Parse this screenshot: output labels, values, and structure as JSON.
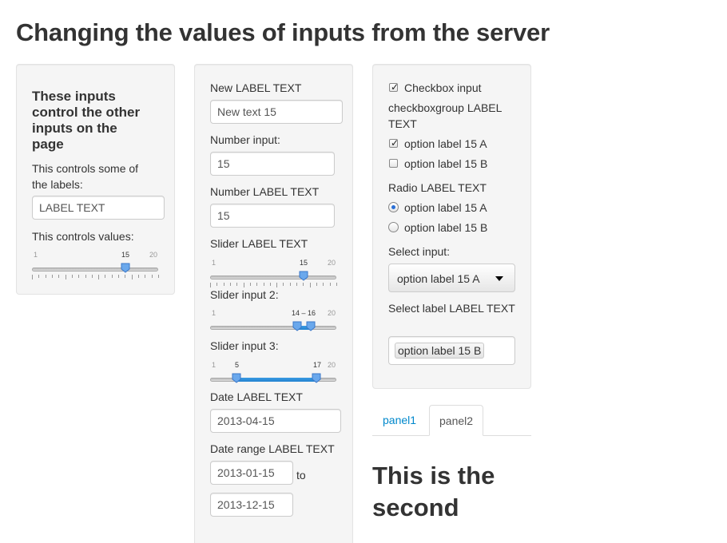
{
  "page_title": "Changing the values of inputs from the server",
  "control_panel": {
    "heading": "These inputs control the other inputs on the page",
    "label_control_label": "This controls some of the labels:",
    "label_control_value": "LABEL TEXT",
    "value_control_label": "This controls values:",
    "slider": {
      "min": 1,
      "max": 20,
      "value": 15,
      "min_label": "1",
      "max_label": "20",
      "value_label": "15"
    }
  },
  "inputs_panel": {
    "new_label": "New LABEL TEXT",
    "new_text_value": "New text 15",
    "number_input_label": "Number input:",
    "number_input_value": "15",
    "number_label_label": "Number LABEL TEXT",
    "number_label_value": "15",
    "slider_label": "Slider LABEL TEXT",
    "slider1": {
      "min": 1,
      "max": 20,
      "value": 15,
      "min_label": "1",
      "max_label": "20",
      "value_label": "15"
    },
    "slider2_label": "Slider input 2:",
    "slider2": {
      "min": 1,
      "max": 20,
      "low": 14,
      "high": 16,
      "min_label": "1",
      "max_label": "20",
      "value_label": "14 – 16"
    },
    "slider3_label": "Slider input 3:",
    "slider3": {
      "min": 1,
      "max": 20,
      "low": 5,
      "high": 17,
      "min_label": "1",
      "max_label": "20",
      "low_label": "5",
      "high_label": "17"
    },
    "date_label": "Date LABEL TEXT",
    "date_value": "2013-04-15",
    "date_range_label": "Date range LABEL TEXT",
    "date_range_start": "2013-01-15",
    "date_range_sep": "to",
    "date_range_end": "2013-12-15"
  },
  "choices_panel": {
    "checkbox_label": "Checkbox input",
    "checkbox_checked": true,
    "group_label": "checkboxgroup LABEL TEXT",
    "group_options": [
      {
        "label": "option label 15 A",
        "checked": true
      },
      {
        "label": "option label 15 B",
        "checked": false
      }
    ],
    "radio_label": "Radio LABEL TEXT",
    "radio_options": [
      {
        "label": "option label 15 A",
        "selected": true
      },
      {
        "label": "option label 15 B",
        "selected": false
      }
    ],
    "select_label": "Select input:",
    "select_value": "option label 15 A",
    "select_label2": "Select label LABEL TEXT",
    "select_value2": "option label 15 B"
  },
  "tabs": {
    "items": [
      {
        "label": "panel1",
        "active": false
      },
      {
        "label": "panel2",
        "active": true
      }
    ],
    "panel_heading": "This is the second"
  },
  "colors": {
    "well_bg": "#f5f5f5",
    "link": "#0088cc",
    "slider_range": "#2a8bd8",
    "handle": "#5a9fe8"
  }
}
